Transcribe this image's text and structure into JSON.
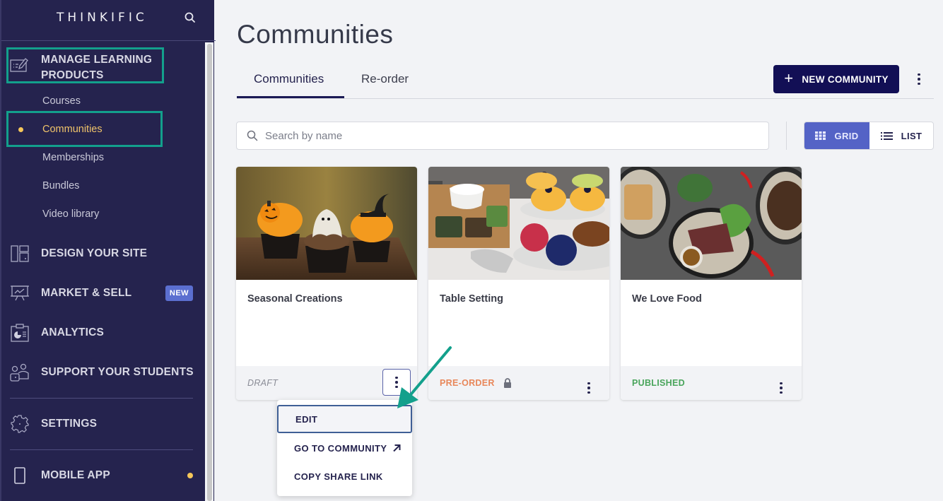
{
  "sidebar": {
    "logo": "THINKIFIC",
    "search_icon": "search-icon",
    "sections": [
      {
        "id": "manage-learning-products",
        "label_line1": "MANAGE LEARNING",
        "label_line2": "PRODUCTS",
        "icon": "edit-list-icon",
        "highlighted": true
      },
      {
        "id": "design-your-site",
        "label": "DESIGN YOUR SITE",
        "icon": "layout-icon"
      },
      {
        "id": "market-and-sell",
        "label": "MARKET & SELL",
        "icon": "presentation-chart-icon",
        "badge": "NEW"
      },
      {
        "id": "analytics",
        "label": "ANALYTICS",
        "icon": "clipboard-pie-icon"
      },
      {
        "id": "support-your-students",
        "label": "SUPPORT YOUR STUDENTS",
        "icon": "users-icon"
      },
      {
        "id": "settings",
        "label": "SETTINGS",
        "icon": "gear-icon"
      },
      {
        "id": "mobile-app",
        "label": "MOBILE APP",
        "icon": "phone-icon",
        "indicator": true
      }
    ],
    "sub_items": [
      {
        "label": "Courses",
        "active": false
      },
      {
        "label": "Communities",
        "active": true
      },
      {
        "label": "Memberships",
        "active": false
      },
      {
        "label": "Bundles",
        "active": false
      },
      {
        "label": "Video library",
        "active": false
      }
    ]
  },
  "main": {
    "title": "Communities",
    "tabs": [
      {
        "label": "Communities",
        "active": true
      },
      {
        "label": "Re-order",
        "active": false
      }
    ],
    "new_button": {
      "plus": "+",
      "label": "NEW COMMUNITY"
    },
    "search": {
      "placeholder": "Search by name",
      "value": ""
    },
    "view_toggle": [
      {
        "label": "GRID",
        "active": true,
        "icon": "grid-icon"
      },
      {
        "label": "LIST",
        "active": false,
        "icon": "list-icon"
      }
    ],
    "cards": [
      {
        "title": "Seasonal Creations",
        "status": "DRAFT",
        "status_color": "#8a8c96",
        "image": "halloween-cupcakes",
        "menu_open": true
      },
      {
        "title": "Table Setting",
        "status": "PRE-ORDER",
        "status_color": "#e8875a",
        "locked": true,
        "image": "afternoon-tea-table"
      },
      {
        "title": "We Love Food",
        "status": "PUBLISHED",
        "status_color": "#4aa55c",
        "image": "steak-salad-bowls"
      }
    ],
    "card_menu": [
      {
        "label": "EDIT",
        "focused": true
      },
      {
        "label": "GO TO COMMUNITY",
        "external": true
      },
      {
        "label": "COPY SHARE LINK"
      }
    ]
  },
  "colors": {
    "sidebar_bg": "#25234e",
    "primary": "#120f55",
    "accent": "#5463c6",
    "highlight_annotation": "#13a08c",
    "active_sub": "#f0c46a"
  }
}
